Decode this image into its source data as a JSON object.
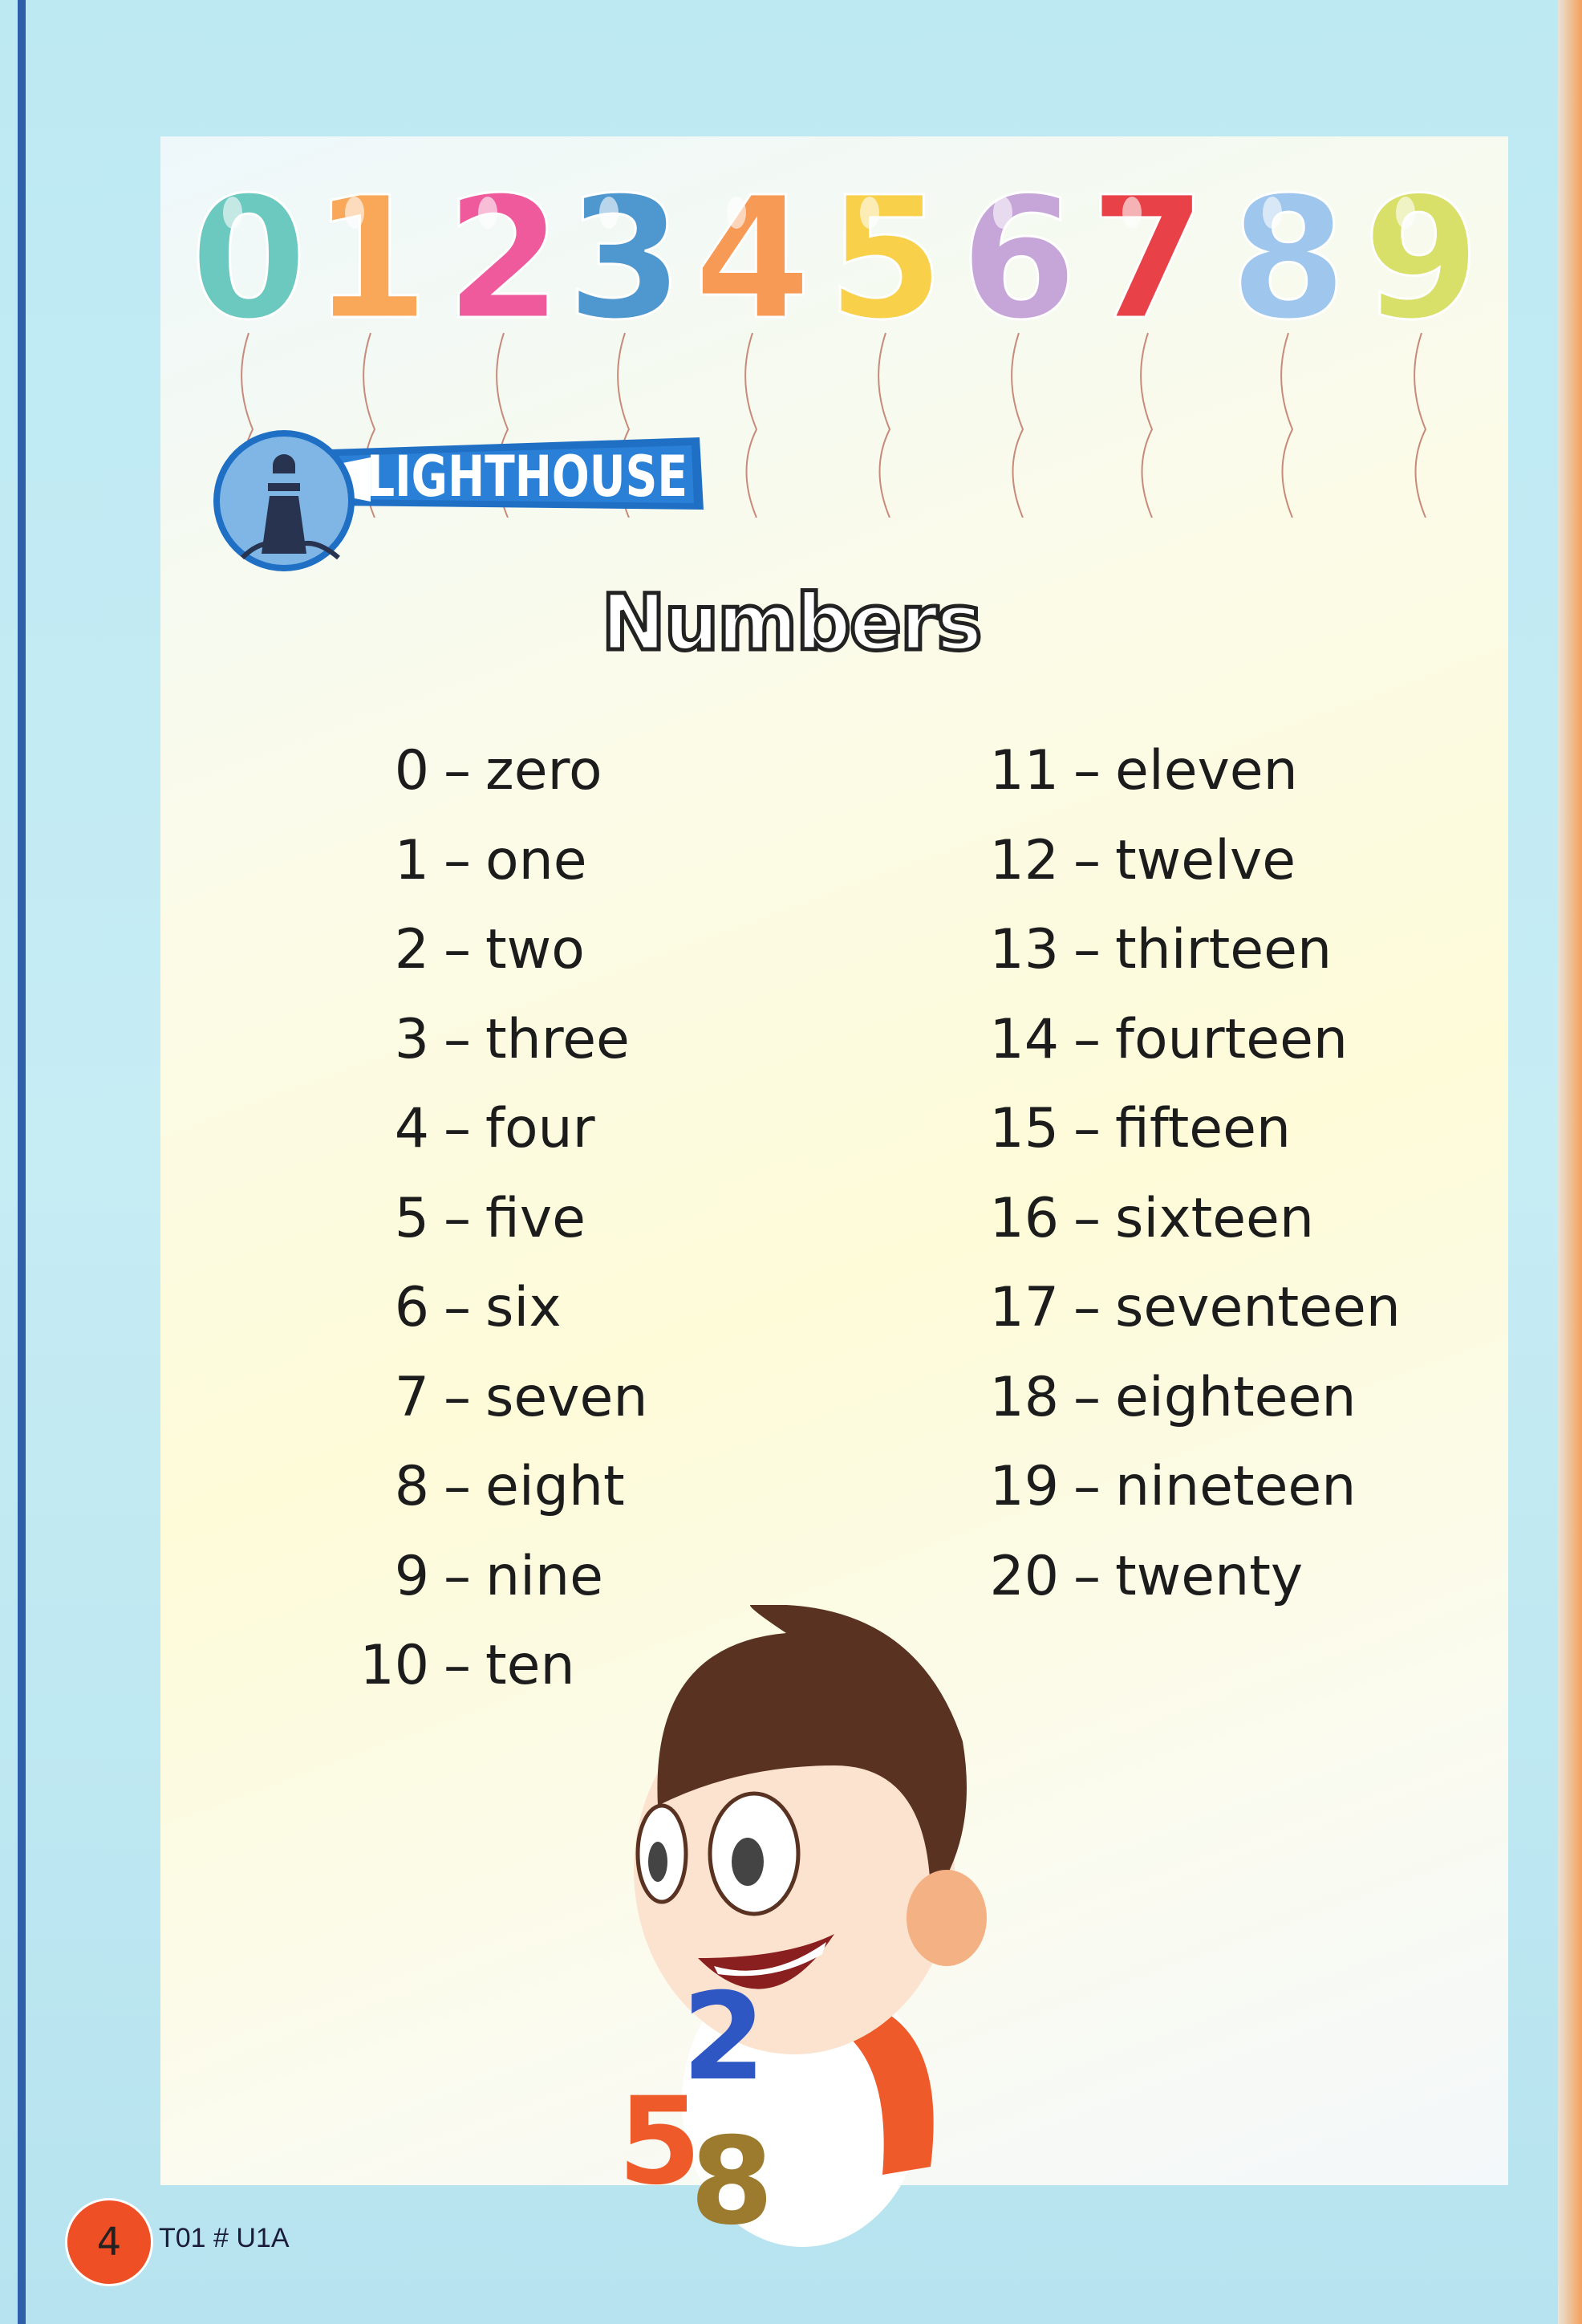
{
  "balloons": [
    {
      "digit": "0",
      "color": "#6cc9bf"
    },
    {
      "digit": "1",
      "color": "#f9a85a"
    },
    {
      "digit": "2",
      "color": "#ee5a9c"
    },
    {
      "digit": "3",
      "color": "#4f97cf"
    },
    {
      "digit": "4",
      "color": "#f79a55"
    },
    {
      "digit": "5",
      "color": "#f8d04a"
    },
    {
      "digit": "6",
      "color": "#c6a6d8"
    },
    {
      "digit": "7",
      "color": "#e84147"
    },
    {
      "digit": "8",
      "color": "#9fc6ec"
    },
    {
      "digit": "9",
      "color": "#d9e06a"
    }
  ],
  "logo": {
    "text": "LIGHTHOUSE"
  },
  "title": "Numbers",
  "left_column": [
    {
      "num": "0",
      "word": "zero"
    },
    {
      "num": "1",
      "word": "one"
    },
    {
      "num": "2",
      "word": "two"
    },
    {
      "num": "3",
      "word": "three"
    },
    {
      "num": "4",
      "word": "four"
    },
    {
      "num": "5",
      "word": "five"
    },
    {
      "num": "6",
      "word": "six"
    },
    {
      "num": "7",
      "word": "seven"
    },
    {
      "num": "8",
      "word": "eight"
    },
    {
      "num": "9",
      "word": "nine"
    },
    {
      "num": "10",
      "word": "ten"
    }
  ],
  "right_column": [
    {
      "num": "11",
      "word": "eleven"
    },
    {
      "num": "12",
      "word": "twelve"
    },
    {
      "num": "13",
      "word": "thirteen"
    },
    {
      "num": "14",
      "word": "fourteen"
    },
    {
      "num": "15",
      "word": "fifteen"
    },
    {
      "num": "16",
      "word": "sixteen"
    },
    {
      "num": "17",
      "word": "seventeen"
    },
    {
      "num": "18",
      "word": "eighteen"
    },
    {
      "num": "19",
      "word": "nineteen"
    },
    {
      "num": "20",
      "word": "twenty"
    }
  ],
  "separator": "–",
  "illustration_digits": [
    "2",
    "5",
    "8"
  ],
  "footer": {
    "page_number": "4",
    "code": "T01 # U1A"
  }
}
